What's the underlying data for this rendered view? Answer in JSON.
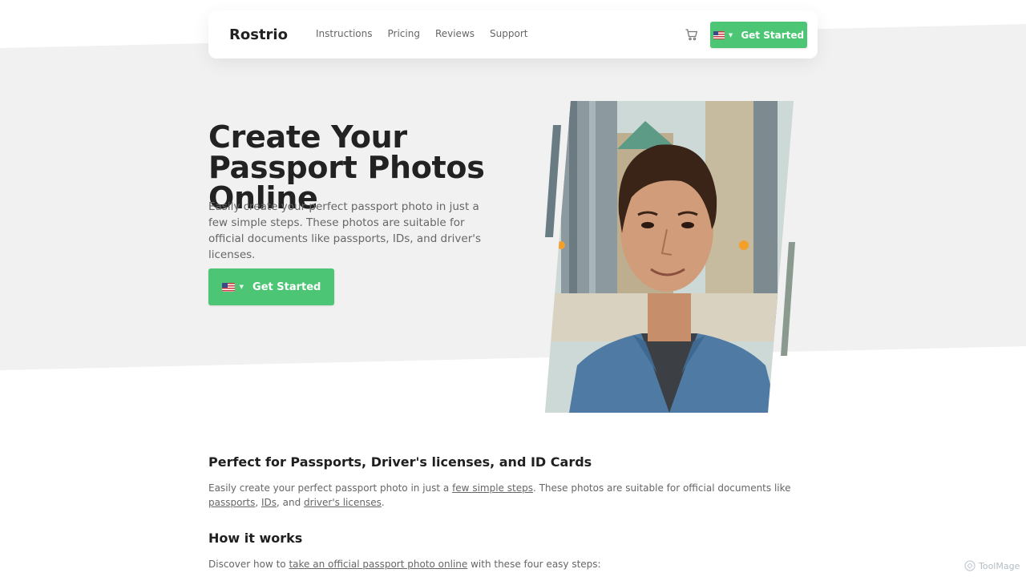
{
  "brand": {
    "logo": "Rostrio"
  },
  "nav": {
    "links": [
      "Instructions",
      "Pricing",
      "Reviews",
      "Support"
    ],
    "cta_label": "Get Started",
    "cart_icon": "cart-icon",
    "flag_icon": "us-flag-icon"
  },
  "hero": {
    "title": "Create Your Passport Photos Online",
    "description": "Easily create your perfect passport photo in just a few simple steps. These photos are suitable for official documents like passports, IDs, and driver's licenses.",
    "cta_label": "Get Started",
    "image_alt": "smiling-man-portrait"
  },
  "section1": {
    "title": "Perfect for Passports, Driver's licenses, and ID Cards",
    "text_before": "Easily create your perfect passport photo in just a ",
    "link1": "few simple steps",
    "text_mid": ". These photos are suitable for official documents like ",
    "link2": "passports",
    "sep1": ", ",
    "link3": "IDs",
    "sep2": ", and ",
    "link4": "driver's licenses",
    "text_end": "."
  },
  "section2": {
    "title": "How it works",
    "text_before": "Discover how to ",
    "link": "take an official passport photo online",
    "text_after": " with these four easy steps:"
  },
  "watermark": "ToolMage",
  "colors": {
    "accent": "#4cc674",
    "hero_bg": "#f0f1f0",
    "text_muted": "#666666"
  }
}
